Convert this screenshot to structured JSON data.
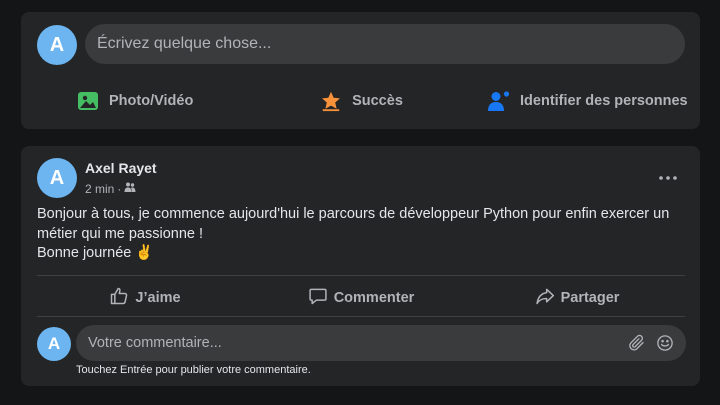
{
  "composer": {
    "avatar_letter": "A",
    "placeholder": "Écrivez quelque chose...",
    "actions": [
      {
        "label": "Photo/Vidéo",
        "icon": "photo-icon",
        "color": "#45bd62"
      },
      {
        "label": "Succès",
        "icon": "star-icon",
        "color": "#f7923a"
      },
      {
        "label": "Identifier des personnes",
        "icon": "tag-person-icon",
        "color": "#1877f2"
      }
    ]
  },
  "post": {
    "avatar_letter": "A",
    "author": "Axel Rayet",
    "time": "2 min",
    "separator": "·",
    "privacy_icon": "friends-icon",
    "more_icon": "more-dots-icon",
    "body_lines": [
      "Bonjour à tous, je commence aujourd'hui le parcours de développeur Python pour enfin exercer un métier qui me passionne !",
      "Bonne journée ✌️"
    ],
    "actions": [
      {
        "label": "J’aime",
        "icon": "like-icon"
      },
      {
        "label": "Commenter",
        "icon": "comment-icon"
      },
      {
        "label": "Partager",
        "icon": "share-icon"
      }
    ],
    "comment": {
      "avatar_letter": "A",
      "placeholder": "Votre commentaire...",
      "hint": "Touchez Entrée pour publier votre commentaire.",
      "tools": [
        "paperclip-icon",
        "smiley-icon"
      ]
    }
  },
  "colors": {
    "background": "#141516",
    "card": "#242526",
    "input": "#3a3b3c",
    "avatar": "#6cb5f0",
    "text": "#e4e6eb",
    "muted": "#b0b3b8"
  }
}
